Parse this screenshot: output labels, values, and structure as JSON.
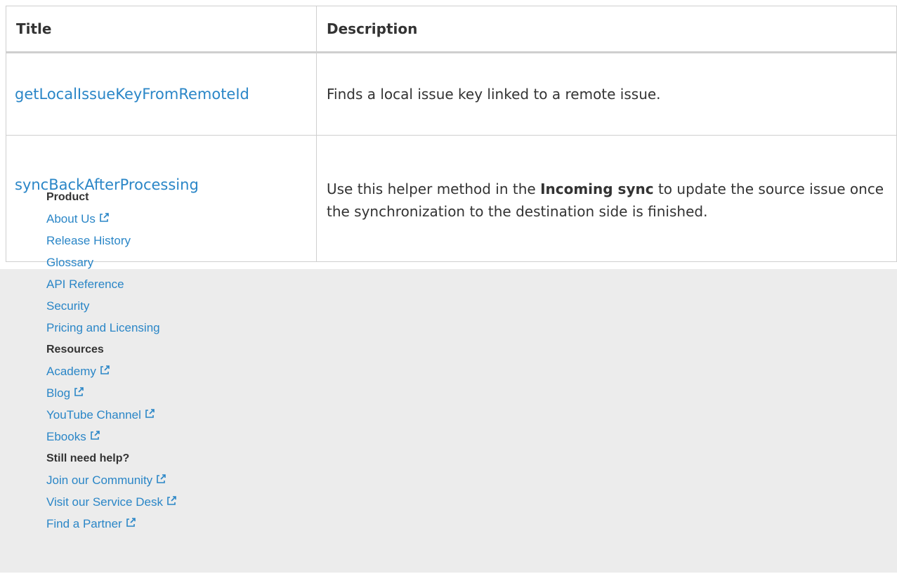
{
  "table": {
    "headers": {
      "title": "Title",
      "description": "Description"
    },
    "rows": [
      {
        "title": "getLocalIssueKeyFromRemoteId",
        "description": "Finds a local issue key linked to a remote issue."
      },
      {
        "title": "syncBackAfterProcessing",
        "description_before": "Use this helper method in the ",
        "description_strong": "Incoming sync",
        "description_after": " to update the source issue once the synchronization to the destination side is finished."
      }
    ]
  },
  "footer": {
    "sections": [
      {
        "heading": "Product",
        "links": [
          {
            "label": "About Us",
            "external": true
          },
          {
            "label": "Release History",
            "external": false
          },
          {
            "label": "Glossary",
            "external": false
          },
          {
            "label": "API Reference",
            "external": false
          },
          {
            "label": "Security",
            "external": false
          },
          {
            "label": "Pricing and Licensing",
            "external": false
          }
        ]
      },
      {
        "heading": "Resources",
        "links": [
          {
            "label": "Academy",
            "external": true
          },
          {
            "label": "Blog",
            "external": true
          },
          {
            "label": "YouTube Channel",
            "external": true
          },
          {
            "label": "Ebooks",
            "external": true
          }
        ]
      },
      {
        "heading": "Still need help?",
        "links": [
          {
            "label": "Join our Community",
            "external": true
          },
          {
            "label": "Visit our Service Desk",
            "external": true
          },
          {
            "label": "Find a Partner",
            "external": true
          }
        ]
      }
    ]
  },
  "colors": {
    "link": "#2a86c7",
    "text": "#333333",
    "footer_bg": "#ececec",
    "border": "#cfcfcf"
  },
  "icons": {
    "external_link": "external-link-icon"
  }
}
